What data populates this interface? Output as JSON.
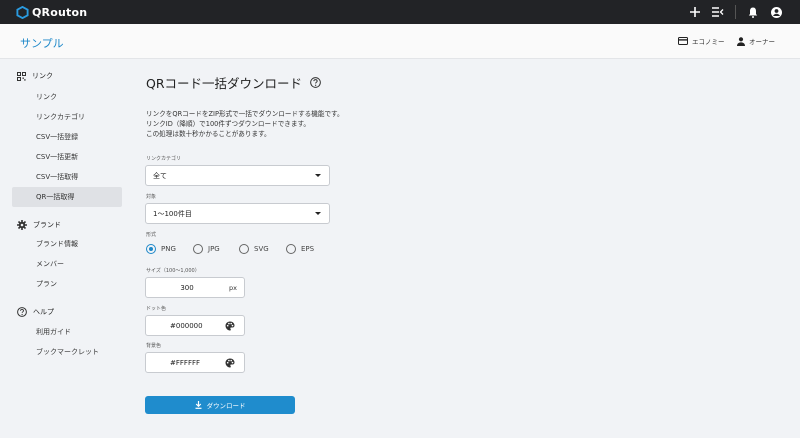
{
  "app": {
    "logo_text": "QRouton"
  },
  "topbar": {
    "icons": [
      "plus-icon",
      "menu-collapse-icon",
      "bell-icon",
      "account-circle-icon"
    ]
  },
  "header": {
    "project_name": "サンプル",
    "plan_label": "エコノミー",
    "role_label": "オーナー"
  },
  "sidebar": {
    "sections": [
      {
        "label": "リンク",
        "icon": "grid-icon",
        "items": [
          "リンク",
          "リンクカテゴリ",
          "CSV一括登録",
          "CSV一括更新",
          "CSV一括取得",
          "QR一括取得"
        ]
      },
      {
        "label": "ブランド",
        "icon": "gear-icon",
        "items": [
          "ブランド情報",
          "メンバー",
          "プラン"
        ]
      },
      {
        "label": "ヘルプ",
        "icon": "help-icon",
        "items": [
          "利用ガイド",
          "ブックマークレット"
        ]
      }
    ],
    "active_item": "QR一括取得"
  },
  "main": {
    "title": "QRコード一括ダウンロード",
    "description": [
      "リンクをQRコードをZIP形式で一括でダウンロードする機能です。",
      "リンクID（降順）で100件ずつダウンロードできます。",
      "この処理は数十秒かかることがあります。"
    ],
    "category": {
      "label": "リンクカテゴリ",
      "value": "全て"
    },
    "target": {
      "label": "対象",
      "value": "1〜100件目"
    },
    "format": {
      "label": "形式",
      "options": [
        "PNG",
        "JPG",
        "SVG",
        "EPS"
      ],
      "selected": "PNG"
    },
    "size": {
      "label": "サイズ（100〜1,000）",
      "value": "300",
      "unit": "px"
    },
    "dot_color": {
      "label": "ドット色",
      "value": "#000000"
    },
    "bg_color": {
      "label": "背景色",
      "value": "#FFFFFF"
    },
    "download_label": "ダウンロード"
  },
  "colors": {
    "accent": "#1f8ccd",
    "topbar": "#222326"
  }
}
